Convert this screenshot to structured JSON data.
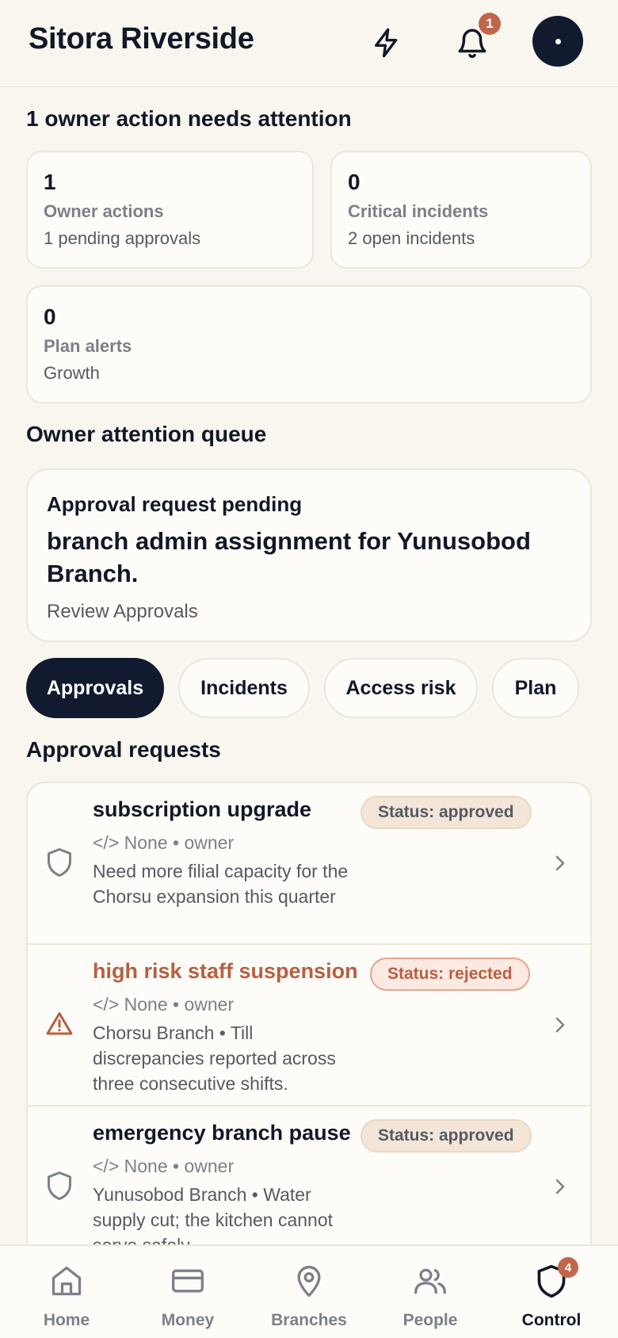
{
  "header": {
    "title": "Sitora Riverside",
    "notification_count": "1",
    "icons": {
      "quick": "lightning-icon",
      "notifications": "bell-icon",
      "profile": "avatar"
    }
  },
  "summary": {
    "title": "1 owner action needs attention",
    "cards": [
      {
        "value": "1",
        "label": "Owner actions",
        "sub": "1 pending approvals"
      },
      {
        "value": "0",
        "label": "Critical incidents",
        "sub": "2 open incidents"
      },
      {
        "value": "0",
        "label": "Plan alerts",
        "sub": "Growth"
      }
    ]
  },
  "queue": {
    "title": "Owner attention queue",
    "card": {
      "kicker": "Approval request pending",
      "headline": "branch admin assignment for Yunusobod Branch.",
      "link": "Review Approvals"
    }
  },
  "filters": {
    "active": "Approvals",
    "items": [
      "Approvals",
      "Incidents",
      "Access risk",
      "Plan"
    ]
  },
  "requests": {
    "title": "Approval requests",
    "items": [
      {
        "title": "subscription upgrade",
        "meta": "</> None • owner",
        "description": "Need more filial capacity for the Chorsu expansion this quarter",
        "status": "Status: approved",
        "icon": "shield-icon"
      },
      {
        "title": "high risk staff suspension",
        "meta": "</> None • owner",
        "description": "Chorsu Branch • Till discrepancies reported across three consecutive shifts.",
        "status": "Status: rejected",
        "icon": "warning-icon"
      },
      {
        "title": "emergency branch pause",
        "meta": "</> None • owner",
        "description": "Yunusobod Branch • Water supply cut; the kitchen cannot serve safely.",
        "status": "Status: approved",
        "icon": "shield-icon"
      }
    ]
  },
  "tabbar": {
    "items": [
      {
        "label": "Home",
        "icon": "home-icon"
      },
      {
        "label": "Money",
        "icon": "card-icon"
      },
      {
        "label": "Branches",
        "icon": "map-pin-icon"
      },
      {
        "label": "People",
        "icon": "users-icon"
      },
      {
        "label": "Control",
        "icon": "shield-icon",
        "badge": "4"
      }
    ],
    "active": "Control"
  },
  "colors": {
    "background": "#f8f6ef",
    "primary_dark": "#111a2e",
    "accent": "#c0674a",
    "danger_text": "#b8603f"
  }
}
